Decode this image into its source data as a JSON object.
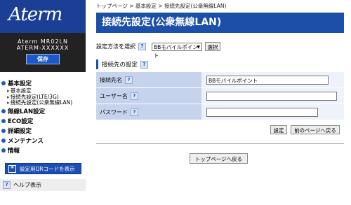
{
  "logo": {
    "text": "Aterm"
  },
  "device": {
    "model": "Aterm MR02LN",
    "serial": "ATERM-XXXXXX",
    "save_label": "保存"
  },
  "menu": [
    {
      "label": "基本設定",
      "subs": [
        "基本設定",
        "接続先設定(LTE/3G)",
        "接続先設定(公衆無線LAN)"
      ]
    },
    {
      "label": "無線LAN設定",
      "subs": []
    },
    {
      "label": "ECO設定",
      "subs": []
    },
    {
      "label": "詳細設定",
      "subs": []
    },
    {
      "label": "メンテナンス",
      "subs": []
    },
    {
      "label": "情報",
      "subs": []
    }
  ],
  "qr_button": {
    "label": "設定用QRコードを表示",
    "icon": "qr-icon"
  },
  "help": {
    "label": "ヘルプ表示",
    "icon": "help-icon"
  },
  "breadcrumb": "トップページ > 基本設定 > 接続先設定(公衆無線LAN)",
  "title": "接続先設定(公衆無線LAN)",
  "method": {
    "label": "設定方法を選択",
    "selected": "BBモバイルポイント",
    "select_button": "選択"
  },
  "section_title": "接続先の設定",
  "fields": [
    {
      "label": "接続先名",
      "value": "BBモバイルポイント"
    },
    {
      "label": "ユーザー名",
      "value": ""
    },
    {
      "label": "パスワード",
      "value": ""
    }
  ],
  "buttons": {
    "set": "設定",
    "back": "前のページへ戻る",
    "top": "トップページへ戻る"
  },
  "help_mark": "?",
  "colors": {
    "brand": "#1b3f95",
    "title_bar": "#1b4fa8",
    "label_cell": "#c5d4ec",
    "value_cell": "#eef2fa"
  }
}
